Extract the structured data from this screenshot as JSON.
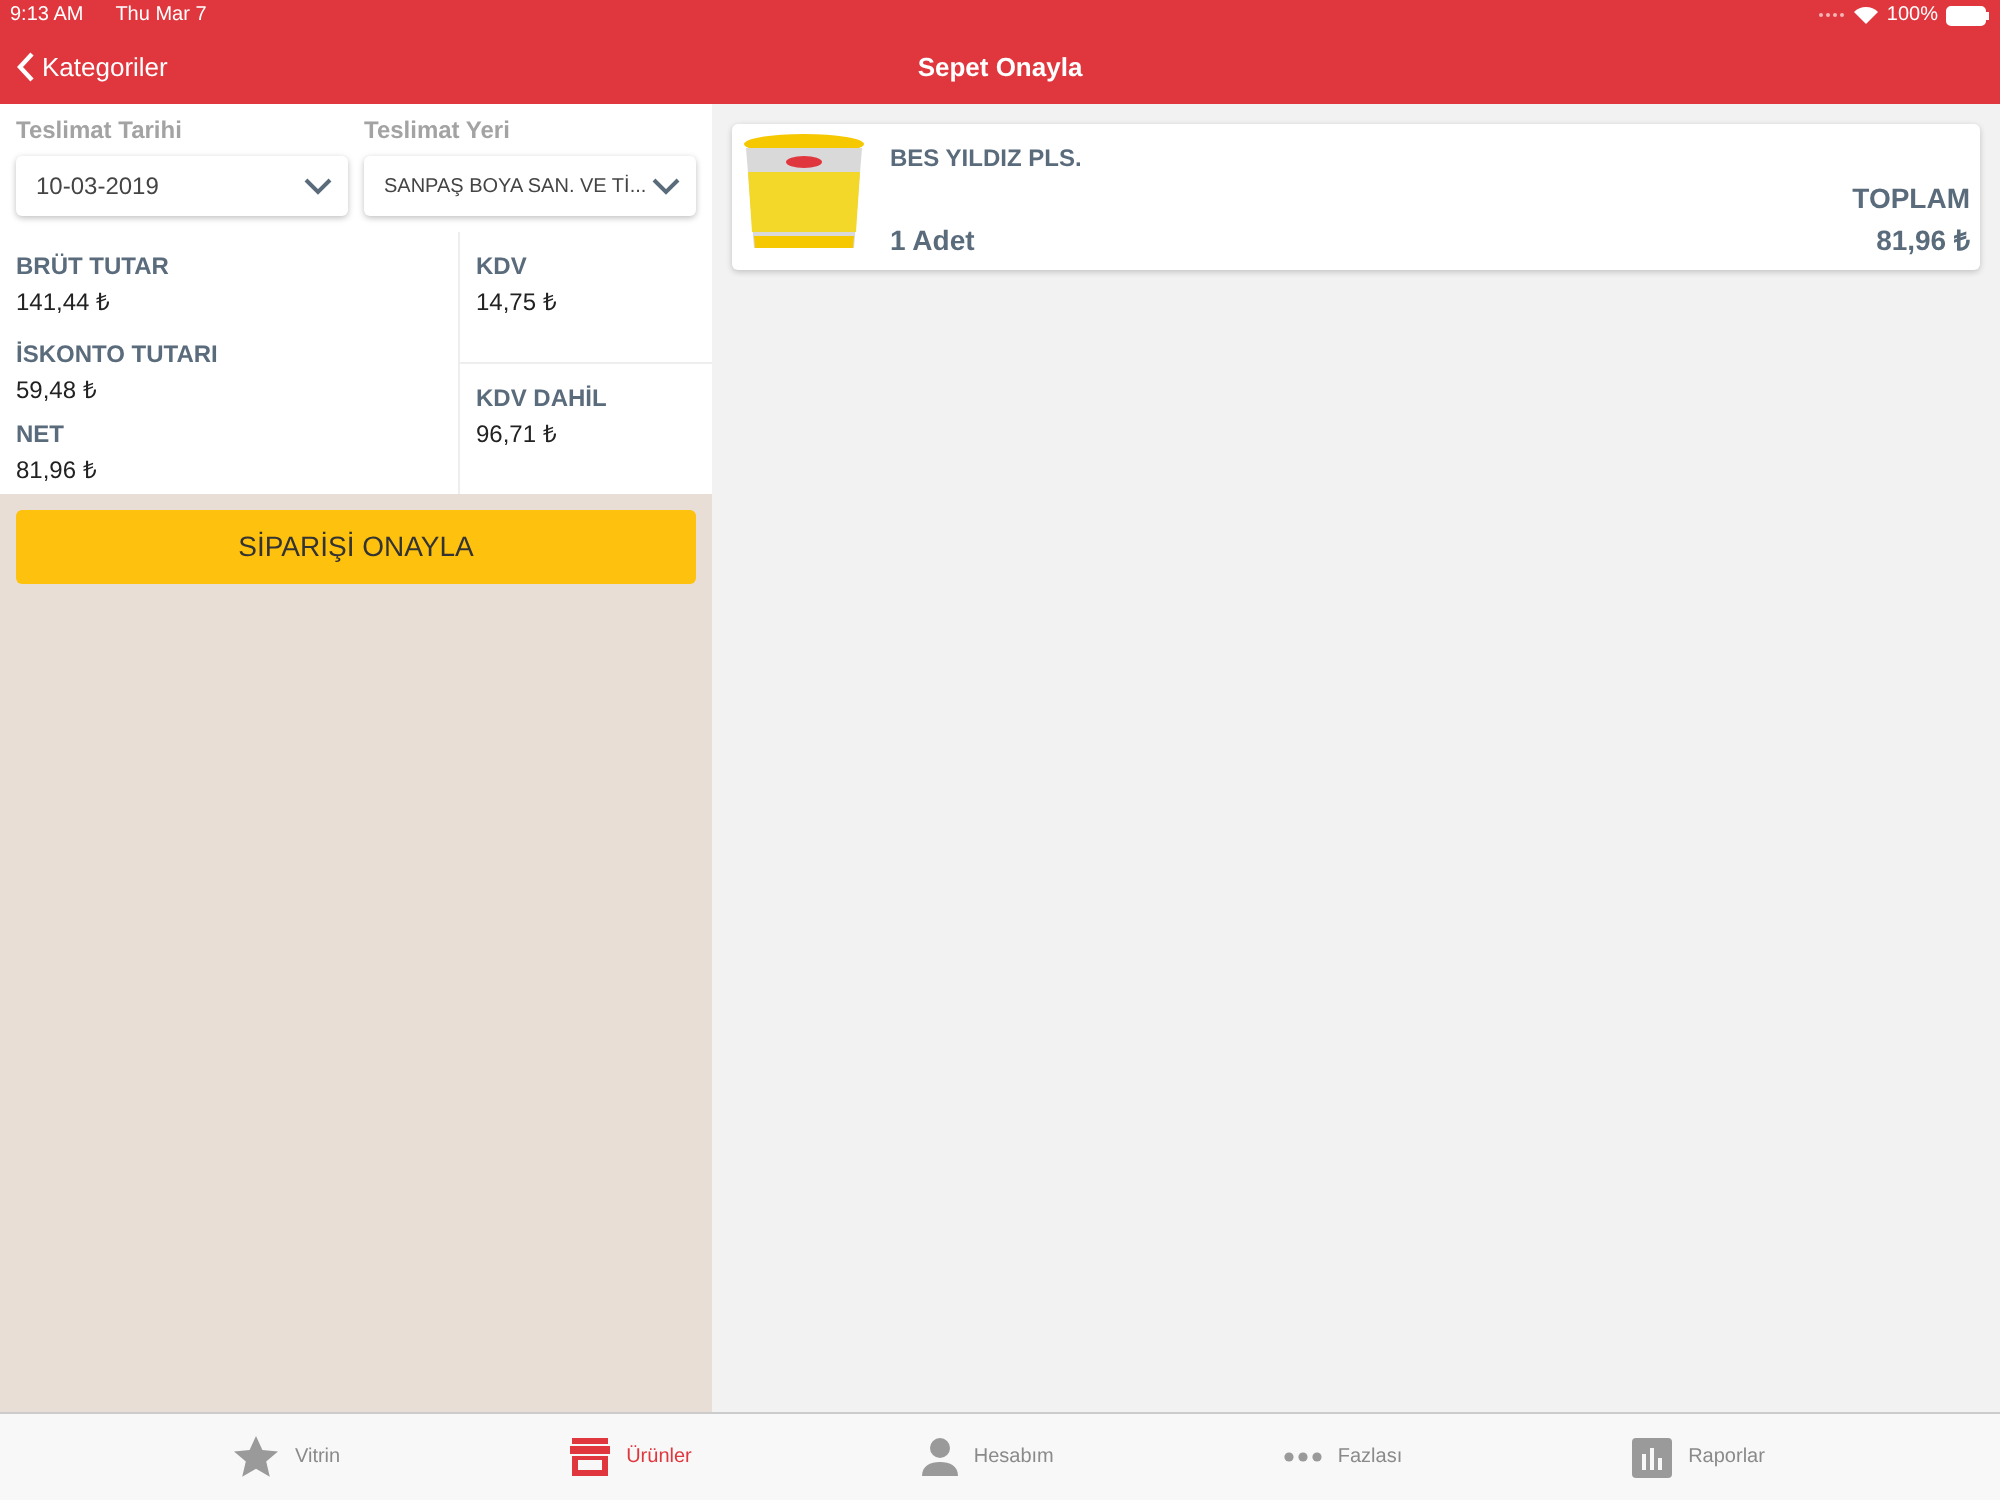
{
  "status_bar": {
    "time": "9:13 AM",
    "date": "Thu Mar 7",
    "battery": "100%"
  },
  "nav": {
    "back": "Kategoriler",
    "title": "Sepet Onayla"
  },
  "delivery": {
    "date_label": "Teslimat Tarihi",
    "date_value": "10-03-2019",
    "place_label": "Teslimat Yeri",
    "place_value": "SANPAŞ BOYA SAN. VE Tİ..."
  },
  "totals_left": [
    {
      "label": "BRÜT TUTAR",
      "value": "141,44 ₺"
    },
    {
      "label": "İSKONTO TUTARI",
      "value": "59,48 ₺"
    },
    {
      "label": "NET",
      "value": "81,96 ₺"
    }
  ],
  "totals_right": [
    {
      "label": "KDV",
      "value": "14,75 ₺"
    },
    {
      "label": "KDV DAHİL",
      "value": "96,71 ₺"
    }
  ],
  "confirm_button": "SİPARİŞİ ONAYLA",
  "cart_items": [
    {
      "name": "BES YILDIZ PLS.",
      "quantity": "1 Adet",
      "total_label": "TOPLAM",
      "total": "81,96 ₺"
    }
  ],
  "tabs": [
    {
      "label": "Vitrin",
      "kind": "star",
      "selected": false
    },
    {
      "label": "Ürünler",
      "kind": "store",
      "selected": true
    },
    {
      "label": "Hesabım",
      "kind": "person",
      "selected": false
    },
    {
      "label": "Fazlası",
      "kind": "dots",
      "selected": false
    },
    {
      "label": "Raporlar",
      "kind": "chart",
      "selected": false
    }
  ]
}
